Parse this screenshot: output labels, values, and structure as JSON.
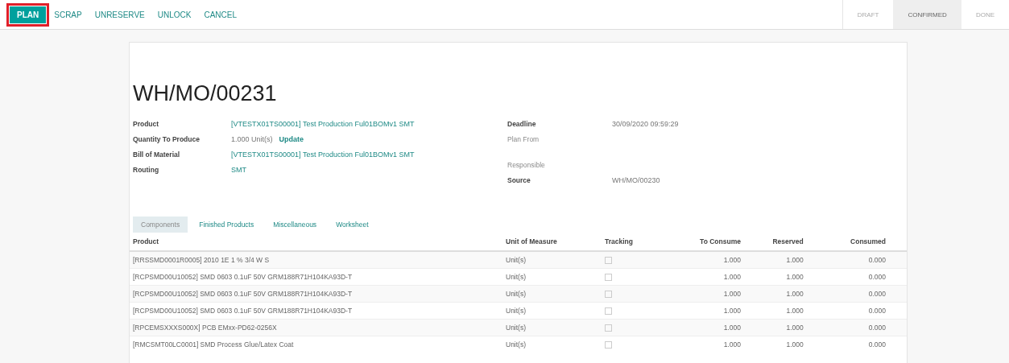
{
  "toolbar": {
    "buttons": [
      {
        "label": "PLAN",
        "kind": "primary",
        "highlighted": true
      },
      {
        "label": "SCRAP",
        "kind": "link",
        "highlighted": false
      },
      {
        "label": "UNRESERVE",
        "kind": "link",
        "highlighted": false
      },
      {
        "label": "UNLOCK",
        "kind": "link",
        "highlighted": false
      },
      {
        "label": "CANCEL",
        "kind": "link",
        "highlighted": false
      }
    ],
    "status_steps": [
      {
        "label": "DRAFT",
        "selected": false
      },
      {
        "label": "CONFIRMED",
        "selected": true
      },
      {
        "label": "DONE",
        "selected": false
      }
    ]
  },
  "form": {
    "title": "WH/MO/00231",
    "left_fields": [
      {
        "label": "Product",
        "value": "[VTESTX01TS00001] Test Production Ful01BOMv1 SMT",
        "kind": "link",
        "empty": false
      },
      {
        "label": "Quantity To Produce",
        "value": "1.000 Unit(s)",
        "action": "Update",
        "kind": "qty",
        "empty": false
      },
      {
        "label": "Bill of Material",
        "value": "[VTESTX01TS00001] Test Production Ful01BOMv1 SMT",
        "kind": "link",
        "empty": false
      },
      {
        "label": "Routing",
        "value": "SMT",
        "kind": "link",
        "empty": false
      }
    ],
    "right_fields": [
      {
        "label": "Deadline",
        "value": "30/09/2020 09:59:29",
        "kind": "text",
        "empty": false
      },
      {
        "label": "Plan From",
        "kind": "text",
        "empty": true
      },
      {
        "label": "Responsible",
        "kind": "text",
        "empty": true
      },
      {
        "label": "Source",
        "value": "WH/MO/00230",
        "kind": "text",
        "empty": false
      }
    ],
    "tabs": [
      {
        "label": "Components",
        "selected": true
      },
      {
        "label": "Finished Products",
        "selected": false
      },
      {
        "label": "Miscellaneous",
        "selected": false
      },
      {
        "label": "Worksheet",
        "selected": false
      }
    ],
    "table": {
      "columns": [
        "Product",
        "Unit of Measure",
        "Tracking",
        "To Consume",
        "Reserved",
        "Consumed"
      ],
      "rows": [
        {
          "product": "[RRSSMD0001R0005] 2010 1E 1 % 3/4 W S",
          "uom": "Unit(s)",
          "tracked": false,
          "to_consume": "1.000",
          "reserved": "1.000",
          "consumed": "0.000"
        },
        {
          "product": "[RCPSMD00U10052] SMD 0603 0.1uF 50V GRM188R71H104KA93D-T",
          "uom": "Unit(s)",
          "tracked": false,
          "to_consume": "1.000",
          "reserved": "1.000",
          "consumed": "0.000"
        },
        {
          "product": "[RCPSMD00U10052] SMD 0603 0.1uF 50V GRM188R71H104KA93D-T",
          "uom": "Unit(s)",
          "tracked": false,
          "to_consume": "1.000",
          "reserved": "1.000",
          "consumed": "0.000"
        },
        {
          "product": "[RCPSMD00U10052] SMD 0603 0.1uF 50V GRM188R71H104KA93D-T",
          "uom": "Unit(s)",
          "tracked": false,
          "to_consume": "1.000",
          "reserved": "1.000",
          "consumed": "0.000"
        },
        {
          "product": "[RPCEMSXXXS000X] PCB EMxx-PD62-0256X",
          "uom": "Unit(s)",
          "tracked": false,
          "to_consume": "1.000",
          "reserved": "1.000",
          "consumed": "0.000"
        },
        {
          "product": "[RMCSMT00LC0001] SMD Process Glue/Latex Coat",
          "uom": "Unit(s)",
          "tracked": false,
          "to_consume": "1.000",
          "reserved": "1.000",
          "consumed": "0.000"
        }
      ]
    }
  }
}
